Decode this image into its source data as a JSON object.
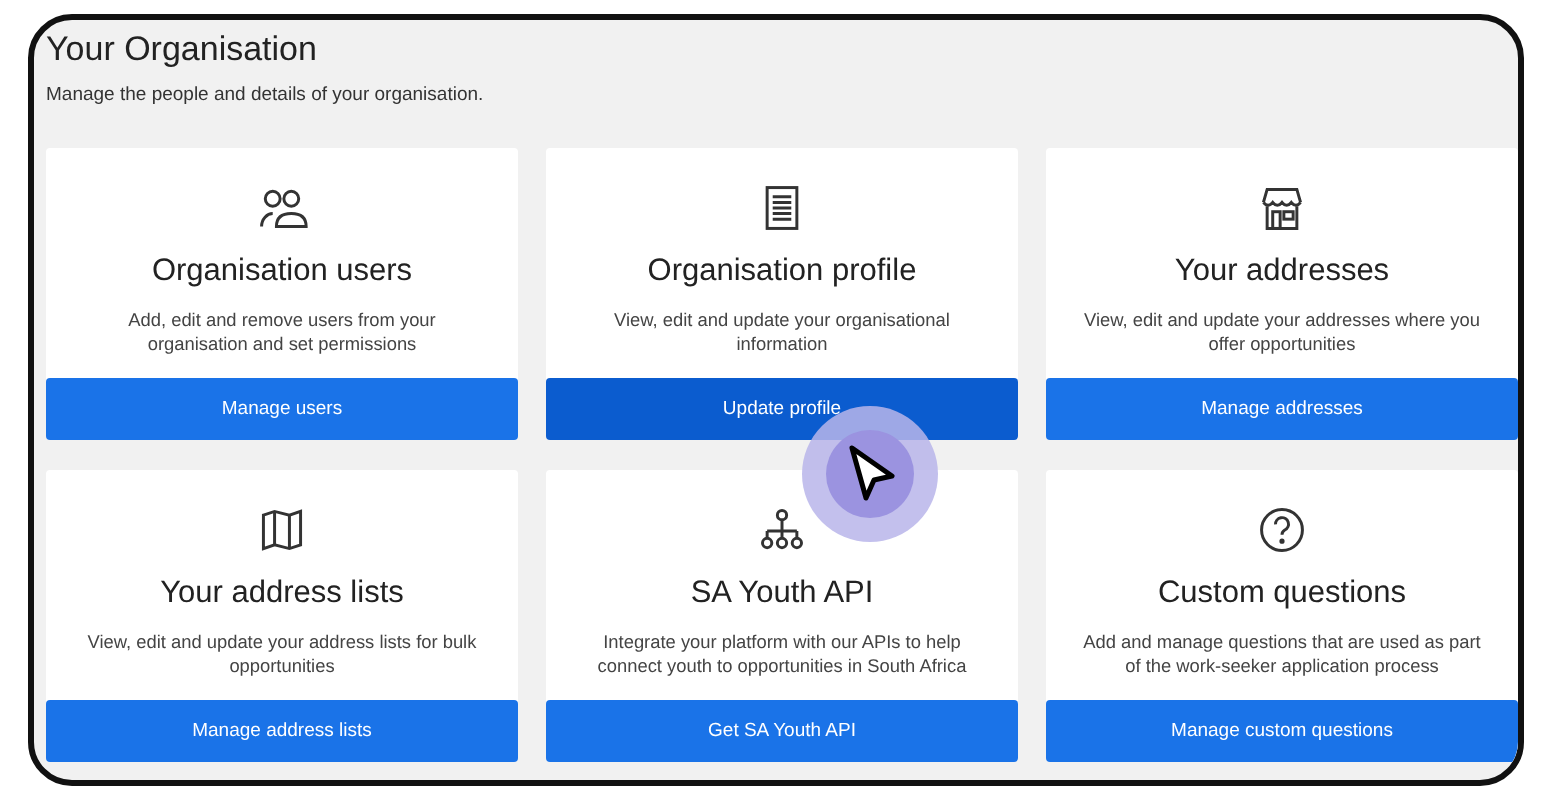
{
  "page": {
    "title": "Your Organisation",
    "subtitle": "Manage the people and details of your organisation."
  },
  "cards": [
    {
      "title": "Organisation users",
      "description": "Add, edit and remove users from your organisation and set permissions",
      "button": "Manage users",
      "hovered": false
    },
    {
      "title": "Organisation profile",
      "description": "View, edit and update your organisational information",
      "button": "Update profile",
      "hovered": true
    },
    {
      "title": "Your addresses",
      "description": "View, edit and update your addresses where you offer opportunities",
      "button": "Manage addresses",
      "hovered": false
    },
    {
      "title": "Your address lists",
      "description": "View, edit and update your address lists for bulk opportunities",
      "button": "Manage address lists",
      "hovered": false
    },
    {
      "title": "SA Youth API",
      "description": "Integrate your platform with our APIs to help connect youth to opportunities in South Africa",
      "button": "Get SA Youth API",
      "hovered": false
    },
    {
      "title": "Custom questions",
      "description": "Add and manage questions that are used as part of the work-seeker application process",
      "button": "Manage custom questions",
      "hovered": false
    }
  ]
}
